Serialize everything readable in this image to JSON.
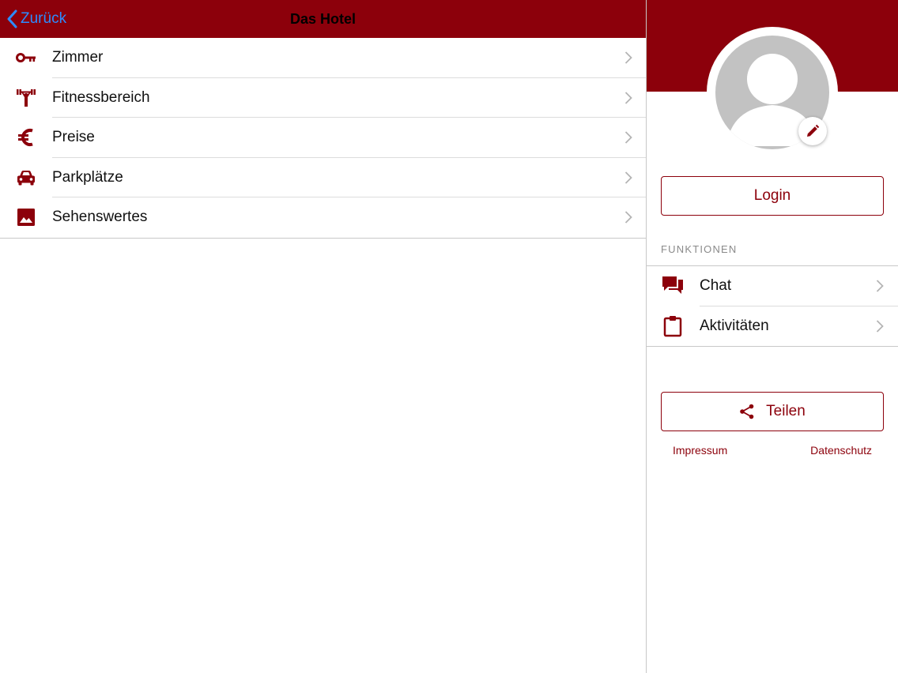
{
  "colors": {
    "brand": "#8c000b",
    "ios_blue": "#2d8cff",
    "avatar_gray": "#c2c2c2"
  },
  "navbar": {
    "back_label": "Zurück",
    "title": "Das Hotel"
  },
  "menu": {
    "items": [
      {
        "label": "Zimmer",
        "icon": "key-icon"
      },
      {
        "label": "Fitnessbereich",
        "icon": "fitness-icon"
      },
      {
        "label": "Preise",
        "icon": "euro-icon"
      },
      {
        "label": "Parkplätze",
        "icon": "car-icon"
      },
      {
        "label": "Sehenswertes",
        "icon": "image-icon"
      }
    ]
  },
  "profile": {
    "avatar_icon": "user-avatar-icon",
    "edit_icon": "pencil-icon",
    "login_label": "Login"
  },
  "functions": {
    "section_title": "FUNKTIONEN",
    "items": [
      {
        "label": "Chat",
        "icon": "chat-icon"
      },
      {
        "label": "Aktivitäten",
        "icon": "clipboard-icon"
      }
    ]
  },
  "share": {
    "label": "Teilen",
    "icon": "share-icon"
  },
  "footer": {
    "impressum": "Impressum",
    "datenschutz": "Datenschutz"
  }
}
